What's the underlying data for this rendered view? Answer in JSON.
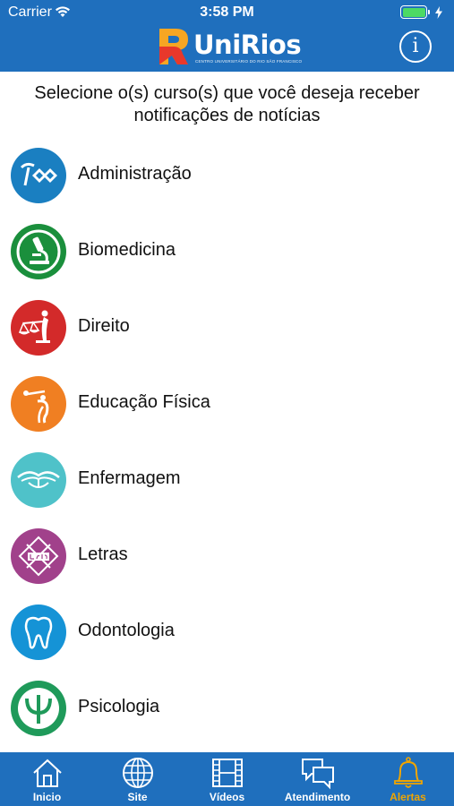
{
  "status_bar": {
    "carrier": "Carrier",
    "time": "3:58 PM"
  },
  "header": {
    "brand": "UniRios",
    "brand_sub": "CENTRO UNIVERSITÁRIO DO RIO SÃO FRANCISCO",
    "info_symbol": "i"
  },
  "instruction": "Selecione o(s) curso(s) que você deseja receber notificações de notícias",
  "courses": [
    {
      "label": "Administração",
      "icon": "administracao-icon",
      "color": "#1a7fc1"
    },
    {
      "label": "Biomedicina",
      "icon": "microscope-icon",
      "color": "#1a8f3c"
    },
    {
      "label": "Direito",
      "icon": "scales-of-justice-icon",
      "color": "#d32a2a"
    },
    {
      "label": "Educação Física",
      "icon": "athlete-icon",
      "color": "#f07f22"
    },
    {
      "label": "Enfermagem",
      "icon": "nursing-icon",
      "color": "#4fc2c9"
    },
    {
      "label": "Letras",
      "icon": "letras-icon",
      "color": "#a1418b"
    },
    {
      "label": "Odontologia",
      "icon": "tooth-icon",
      "color": "#1593d6"
    },
    {
      "label": "Psicologia",
      "icon": "psi-icon",
      "color": "#1f9a5a"
    }
  ],
  "tabs": [
    {
      "label": "Inicio",
      "icon": "home-icon"
    },
    {
      "label": "Site",
      "icon": "globe-icon"
    },
    {
      "label": "Vídeos",
      "icon": "film-icon"
    },
    {
      "label": "Atendimento",
      "icon": "chat-icon"
    },
    {
      "label": "Alertas",
      "icon": "bell-icon",
      "active": true
    }
  ],
  "colors": {
    "primary": "#1f6fbd",
    "active_tab": "#f0a500"
  }
}
